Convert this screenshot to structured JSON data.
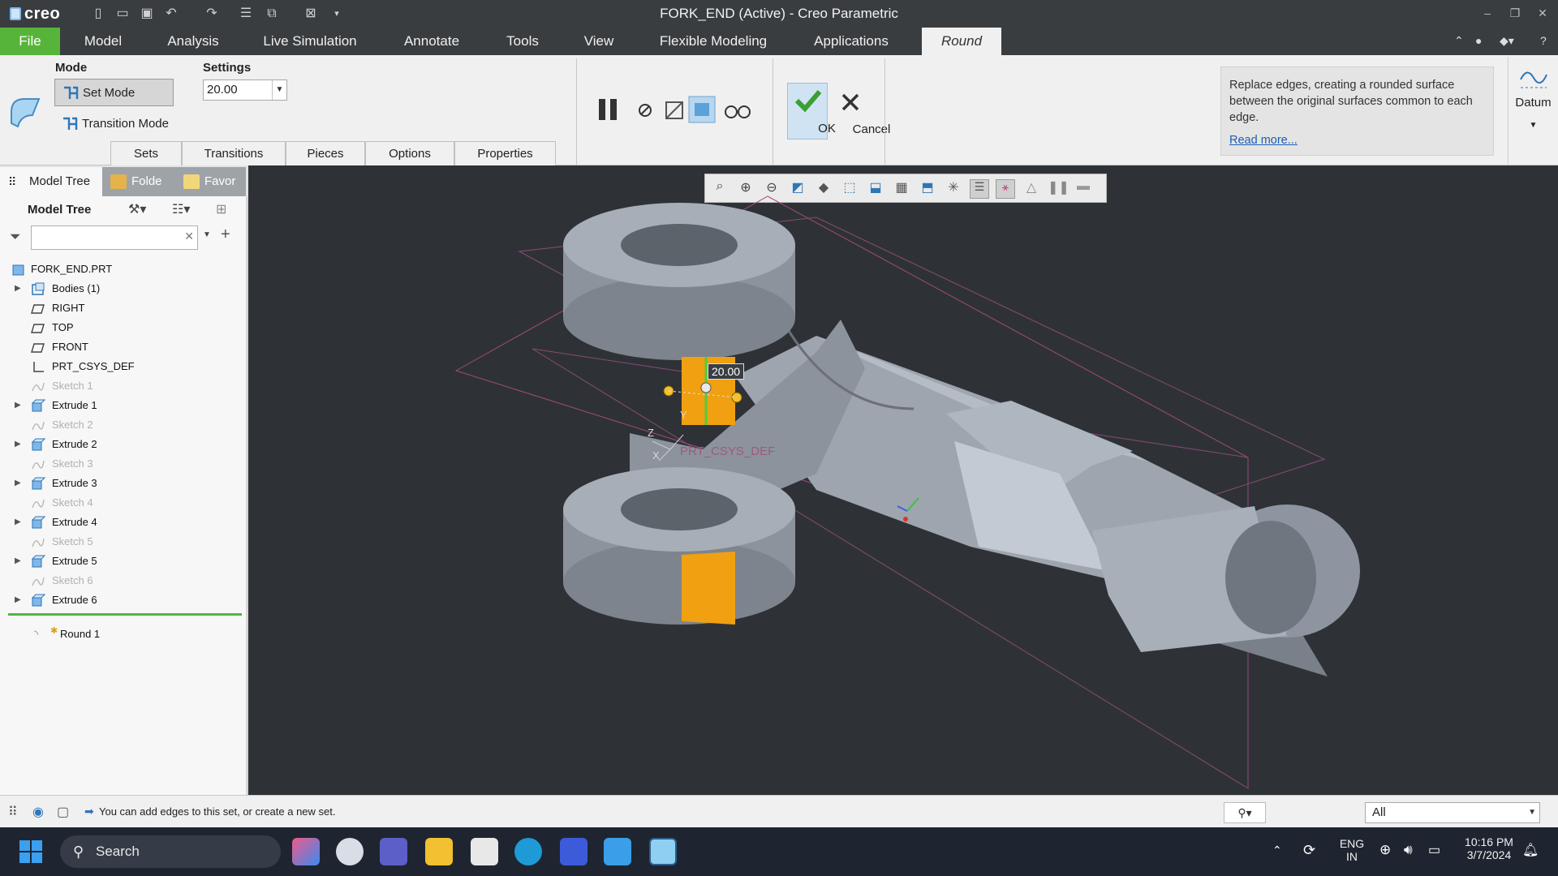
{
  "app": {
    "logo_text": "creo",
    "window_title": "FORK_END (Active) - Creo Parametric"
  },
  "menu": {
    "file": "File",
    "items": [
      "Model",
      "Analysis",
      "Live Simulation",
      "Annotate",
      "Tools",
      "View",
      "Flexible Modeling",
      "Applications"
    ],
    "active_tab": "Round"
  },
  "ribbon": {
    "mode_label": "Mode",
    "set_mode": "Set Mode",
    "transition_mode": "Transition Mode",
    "settings_label": "Settings",
    "radius_value": "20.00",
    "tabs": [
      "Sets",
      "Transitions",
      "Pieces",
      "Options",
      "Properties"
    ],
    "ok": "OK",
    "cancel": "Cancel",
    "help_text": "Replace edges, creating a rounded surface between the original surfaces common to each edge.",
    "help_link": "Read more...",
    "datum": "Datum"
  },
  "panel": {
    "tabs": [
      "Model Tree",
      "Folde",
      "Favor"
    ],
    "tree_title": "Model Tree",
    "tree_items": [
      {
        "label": "FORK_END.PRT",
        "type": "part",
        "expandable": false,
        "dim": false,
        "root": true
      },
      {
        "label": "Bodies (1)",
        "type": "bodies",
        "expandable": true,
        "dim": false
      },
      {
        "label": "RIGHT",
        "type": "plane",
        "expandable": false,
        "dim": false
      },
      {
        "label": "TOP",
        "type": "plane",
        "expandable": false,
        "dim": false
      },
      {
        "label": "FRONT",
        "type": "plane",
        "expandable": false,
        "dim": false
      },
      {
        "label": "PRT_CSYS_DEF",
        "type": "csys",
        "expandable": false,
        "dim": false
      },
      {
        "label": "Sketch 1",
        "type": "sketch",
        "expandable": false,
        "dim": true
      },
      {
        "label": "Extrude 1",
        "type": "extrude",
        "expandable": true,
        "dim": false
      },
      {
        "label": "Sketch 2",
        "type": "sketch",
        "expandable": false,
        "dim": true
      },
      {
        "label": "Extrude 2",
        "type": "extrude",
        "expandable": true,
        "dim": false
      },
      {
        "label": "Sketch 3",
        "type": "sketch",
        "expandable": false,
        "dim": true
      },
      {
        "label": "Extrude 3",
        "type": "extrude",
        "expandable": true,
        "dim": false
      },
      {
        "label": "Sketch 4",
        "type": "sketch",
        "expandable": false,
        "dim": true
      },
      {
        "label": "Extrude 4",
        "type": "extrude",
        "expandable": true,
        "dim": false
      },
      {
        "label": "Sketch 5",
        "type": "sketch",
        "expandable": false,
        "dim": true
      },
      {
        "label": "Extrude 5",
        "type": "extrude",
        "expandable": true,
        "dim": false
      },
      {
        "label": "Sketch 6",
        "type": "sketch",
        "expandable": false,
        "dim": true
      },
      {
        "label": "Extrude 6",
        "type": "extrude",
        "expandable": true,
        "dim": false
      }
    ],
    "active_feature": "Round 1"
  },
  "viewport": {
    "dimension_label": "20.00",
    "csys_label": "PRT_CSYS_DEF",
    "axis_labels": [
      "Y",
      "Z",
      "X"
    ]
  },
  "status": {
    "message": "You can add edges to this set, or create a new set.",
    "filter_value": "All"
  },
  "taskbar": {
    "search": "Search",
    "lang_top": "ENG",
    "lang_bottom": "IN",
    "time": "10:16 PM",
    "date": "3/7/2024"
  },
  "colors": {
    "file_tab": "#57b43a",
    "selection_orange": "#f0a010",
    "model_gray": "#a6adb7"
  }
}
